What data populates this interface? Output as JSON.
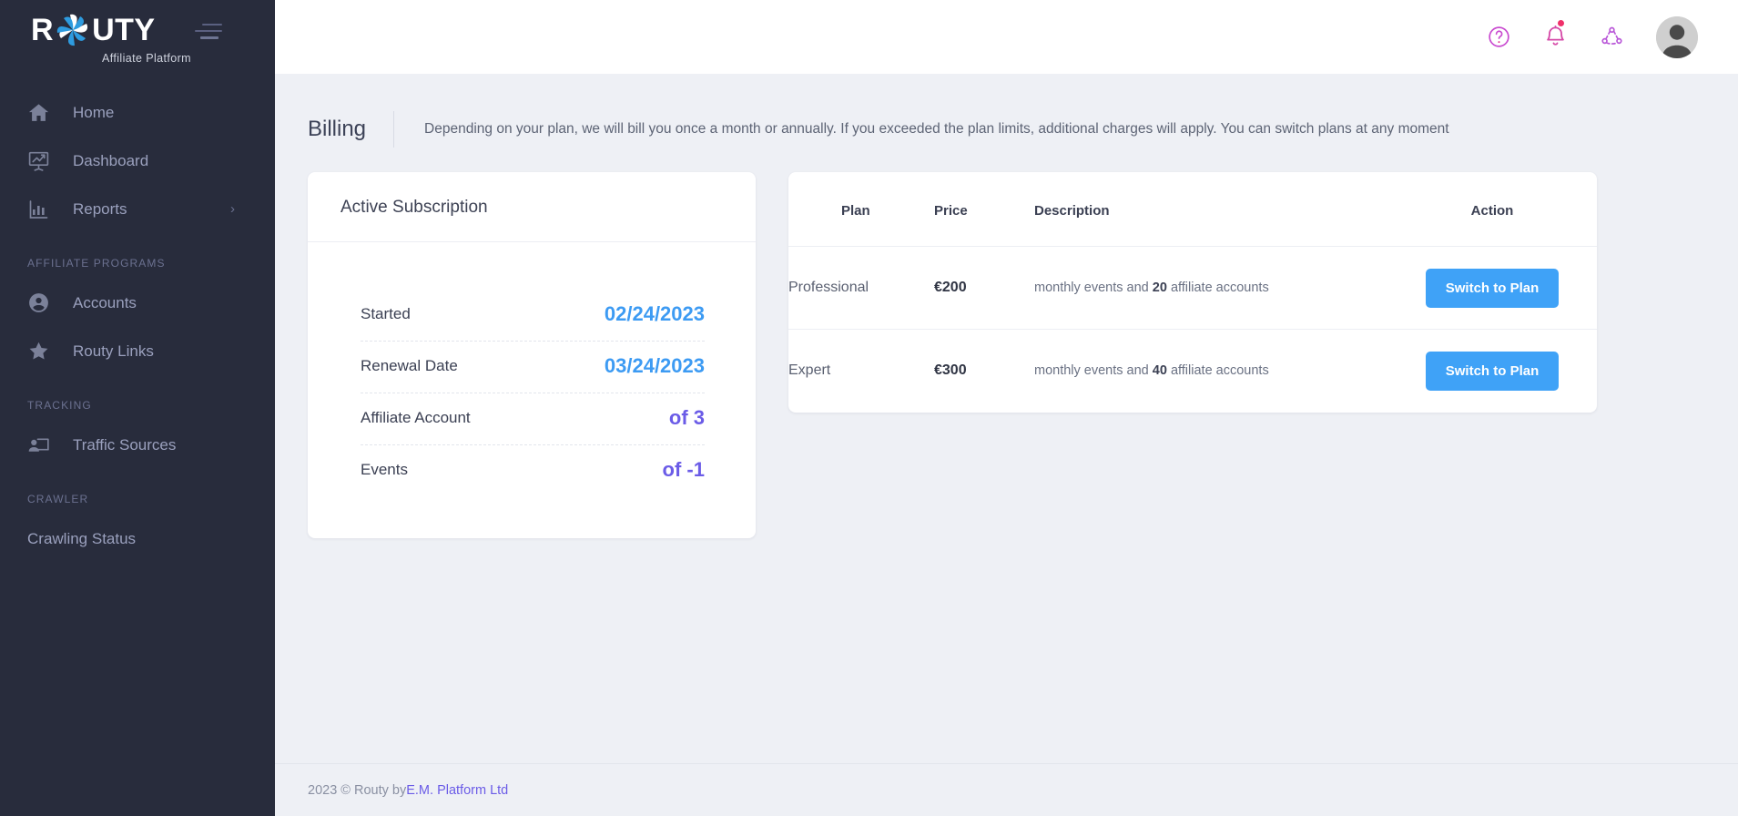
{
  "brand": {
    "name_left": "R",
    "name_right": "UTY",
    "subtitle": "Affiliate Platform",
    "logo_icon": "pinwheel-icon",
    "menu_icon": "hamburger-menu-icon"
  },
  "sidebar": {
    "items": [
      {
        "label": "Home",
        "icon": "home-icon",
        "chevron": ""
      },
      {
        "label": "Dashboard",
        "icon": "presentation-chart-icon",
        "chevron": ""
      },
      {
        "label": "Reports",
        "icon": "bar-chart-icon",
        "chevron": "›"
      }
    ],
    "section_affiliate": "AFFILIATE PROGRAMS",
    "affiliate_items": [
      {
        "label": "Accounts",
        "icon": "user-circle-icon"
      },
      {
        "label": "Routy Links",
        "icon": "star-icon"
      }
    ],
    "section_tracking": "TRACKING",
    "tracking_items": [
      {
        "label": "Traffic Sources",
        "icon": "traffic-source-icon"
      }
    ],
    "section_crawler": "CRAWLER",
    "crawler_items": [
      {
        "label": "Crawling Status",
        "icon": ""
      }
    ]
  },
  "topbar": {
    "help_icon": "help-circle-icon",
    "notifications_icon": "bell-icon",
    "notifications_has_badge": true,
    "share_icon": "share-network-icon",
    "avatar_icon": "user-avatar"
  },
  "header": {
    "title": "Billing",
    "description": "Depending on your plan, we will bill you once a month or annually. If you exceeded the plan limits, additional charges will apply. You can switch plans at any moment"
  },
  "subscription": {
    "title": "Active Subscription",
    "rows": [
      {
        "label": "Started",
        "value": "02/24/2023",
        "color": "blue"
      },
      {
        "label": "Renewal Date",
        "value": "03/24/2023",
        "color": "blue"
      },
      {
        "label": "Affiliate Account",
        "value": "of 3",
        "color": "purple"
      },
      {
        "label": "Events",
        "value": "of -1",
        "color": "purple"
      }
    ]
  },
  "plans": {
    "columns": {
      "plan": "Plan",
      "price": "Price",
      "description": "Description",
      "action": "Action"
    },
    "rows": [
      {
        "plan": "Professional",
        "price": "€200",
        "desc_prefix": "monthly events and ",
        "desc_count": "20",
        "desc_suffix": " affiliate accounts",
        "action_label": "Switch to Plan"
      },
      {
        "plan": "Expert",
        "price": "€300",
        "desc_prefix": "monthly events and ",
        "desc_count": "40",
        "desc_suffix": " affiliate accounts",
        "action_label": "Switch to Plan"
      }
    ]
  },
  "footer": {
    "copyright": "2023 © Routy by ",
    "link": "E.M. Platform Ltd"
  },
  "colors": {
    "sidebar_bg": "#282c3c",
    "page_bg": "#eef0f5",
    "accent_blue": "#3fa2f7",
    "accent_purple": "#6b5ce7",
    "badge_red": "#f0306a"
  }
}
